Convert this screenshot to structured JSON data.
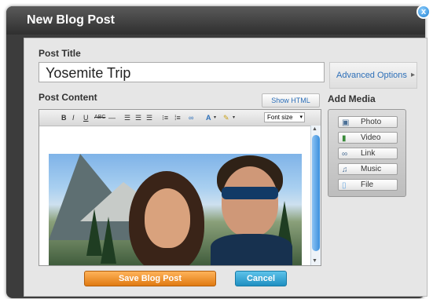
{
  "dialog": {
    "title": "New Blog Post",
    "close_glyph": "x"
  },
  "form": {
    "post_title_label": "Post Title",
    "post_title_value": "Yosemite Trip",
    "advanced_options_label": "Advanced Options",
    "post_content_label": "Post Content",
    "show_html_label": "Show HTML"
  },
  "toolbar": {
    "bold": "B",
    "italic": "I",
    "underline": "U",
    "strikethrough": "ABC",
    "hr": "—",
    "font_size_label": "Font size",
    "font_color": "A"
  },
  "add_media": {
    "heading": "Add Media",
    "items": [
      {
        "label": "Photo",
        "icon": "photo-icon"
      },
      {
        "label": "Video",
        "icon": "video-icon"
      },
      {
        "label": "Link",
        "icon": "link-icon"
      },
      {
        "label": "Music",
        "icon": "music-icon"
      },
      {
        "label": "File",
        "icon": "file-icon"
      }
    ]
  },
  "actions": {
    "save_label": "Save Blog Post",
    "cancel_label": "Cancel"
  },
  "colors": {
    "save_button": "#e8871f",
    "cancel_button": "#2aa2d4",
    "link_text": "#2d6fb8"
  }
}
